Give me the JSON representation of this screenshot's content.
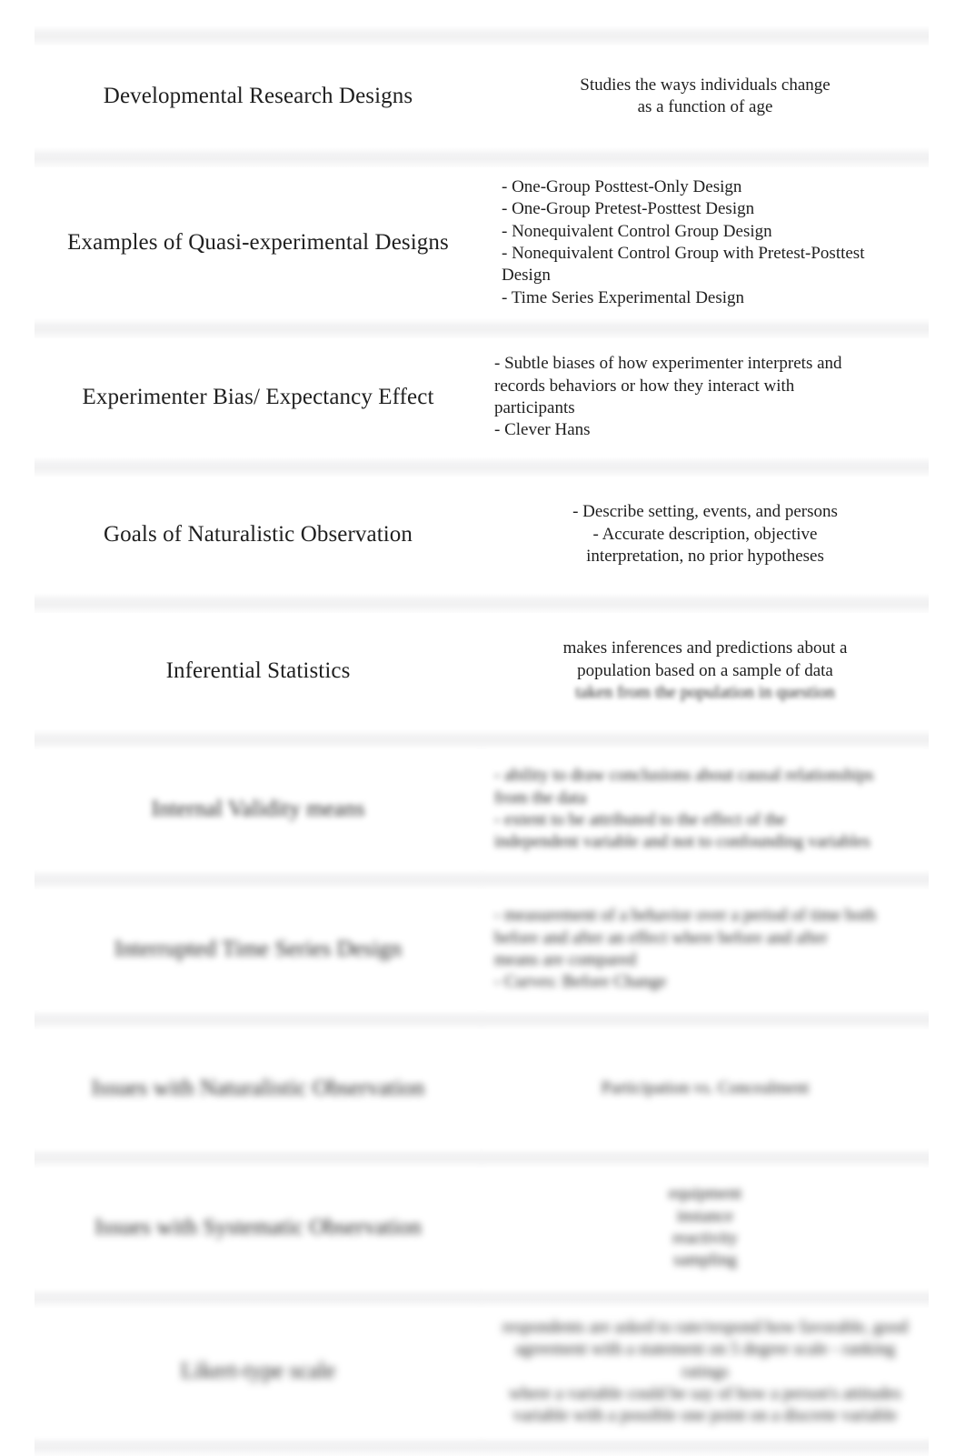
{
  "document": {
    "type": "flashcard-table",
    "columns": [
      "term",
      "definition"
    ],
    "row_count": 10
  },
  "rows": [
    {
      "term": "Developmental Research Designs",
      "definition_lines": [
        "Studies the ways individuals change",
        "as a function of age"
      ],
      "def_align": "center",
      "def_size": "big",
      "clarity": "sharp"
    },
    {
      "term": "Examples of Quasi-experimental Designs",
      "definition_lines": [
        "- One-Group Posttest-Only Design",
        "- One-Group Pretest-Posttest Design",
        "- Nonequivalent Control Group Design",
        "- Nonequivalent Control Group with Pretest-Posttest Design",
        "- Time Series Experimental Design"
      ],
      "def_align": "left",
      "def_size": "small",
      "clarity": "sharp"
    },
    {
      "term": "Experimenter Bias/ Expectancy Effect",
      "definition_lines": [
        "- Subtle biases of how experimenter interprets and",
        "records behaviors or how they interact with",
        "participants",
        "- Clever Hans"
      ],
      "def_align": "left",
      "def_size": "mid",
      "clarity": "sharp"
    },
    {
      "term": "Goals of Naturalistic Observation",
      "definition_lines": [
        "- Describe setting, events, and persons",
        "- Accurate description, objective",
        "interpretation, no prior hypotheses"
      ],
      "def_align": "center",
      "def_size": "normal",
      "clarity": "sharp"
    },
    {
      "term": "Inferential Statistics",
      "definition_lines": [
        "makes inferences and predictions about a",
        "population based on a sample of data"
      ],
      "definition_blurred_tail": "taken from the population in question",
      "def_align": "center",
      "def_size": "normal",
      "clarity": "sharp-fading"
    },
    {
      "term": "Internal Validity means",
      "definition_lines": [
        "- ability to draw conclusions about causal relationships",
        "from the data",
        "- extent to be attributed to the effect of the",
        "independent variable and not to confounding variables"
      ],
      "def_align": "left",
      "def_size": "small",
      "clarity": "blurred"
    },
    {
      "term": "Interrupted Time Series Design",
      "definition_lines": [
        "- measurement of a behavior over a period of time both",
        "before and after an effect where before and after",
        "means are compared",
        "- Curves: Before Change"
      ],
      "def_align": "left",
      "def_size": "small",
      "clarity": "blurred"
    },
    {
      "term": "Issues with Naturalistic Observation",
      "definition_lines": [
        "Participation vs. Concealment"
      ],
      "def_align": "center",
      "def_size": "big",
      "clarity": "blurred"
    },
    {
      "term": "Issues with Systematic Observation",
      "definition_lines": [
        "equipment",
        "instance",
        "reactivity",
        "sampling"
      ],
      "def_align": "center",
      "def_size": "small",
      "clarity": "blurred"
    },
    {
      "term": "Likert-type scale",
      "definition_lines": [
        "respondents are asked to rate/respond how favorable, good",
        "agreement with a statement on 5 degree scale - ranking ratings",
        "where a variable could be say of how a person's attitudes",
        "variable with a possible one point on a discrete variable"
      ],
      "def_align": "center",
      "def_size": "small",
      "clarity": "blurred"
    }
  ],
  "style": {
    "background": "#ffffff",
    "text_color": "#1f1f1f",
    "separator_color": "#f1f1f2",
    "column_divider_color": "#f2f2f3"
  }
}
